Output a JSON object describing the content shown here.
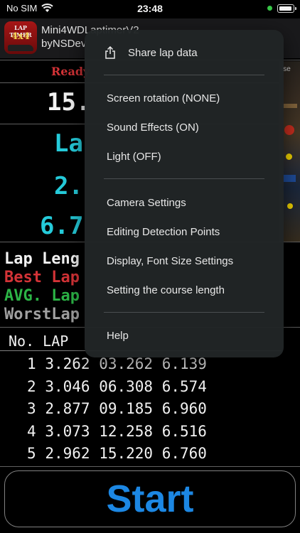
{
  "status_bar": {
    "carrier": "No SIM",
    "time": "23:48"
  },
  "app": {
    "icon_text_1": "LAP TIMER",
    "icon_text_2": "4x4",
    "title_line1": "Mini4WDLaptimerV2",
    "title_line2": "byNSDev"
  },
  "timer": {
    "ready_text": "Ready",
    "big_time": "15.",
    "lap_label": "La",
    "lap_time": "2.",
    "speed": "6.7",
    "camera_label": "ise"
  },
  "stats": {
    "lap_length": "Lap Leng",
    "best_lap": "Best Lap",
    "avg_lap": "AVG. Lap",
    "worst_lap": "WorstLap"
  },
  "table": {
    "header": "No. LAP",
    "rows": [
      {
        "no": "1",
        "lap": "3.262",
        "total": "03.262",
        "speed": "6.139"
      },
      {
        "no": "2",
        "lap": "3.046",
        "total": "06.308",
        "speed": "6.574"
      },
      {
        "no": "3",
        "lap": "2.877",
        "total": "09.185",
        "speed": "6.960"
      },
      {
        "no": "4",
        "lap": "3.073",
        "total": "12.258",
        "speed": "6.516"
      },
      {
        "no": "5",
        "lap": "2.962",
        "total": "15.220",
        "speed": "6.760"
      }
    ]
  },
  "start_button": "Start",
  "menu": {
    "share": "Share lap data",
    "screen_rotation": "Screen rotation (NONE)",
    "sound_effects": "Sound Effects (ON)",
    "light": "Light (OFF)",
    "camera_settings": "Camera Settings",
    "editing_detection": "Editing Detection Points",
    "display_font": "Display, Font Size Settings",
    "course_length": "Setting the course length",
    "help": "Help"
  },
  "colors": {
    "accent_blue": "#1e8ff0",
    "cyan": "#27d6e6",
    "red": "#e0363a",
    "green": "#2fbe4a"
  }
}
